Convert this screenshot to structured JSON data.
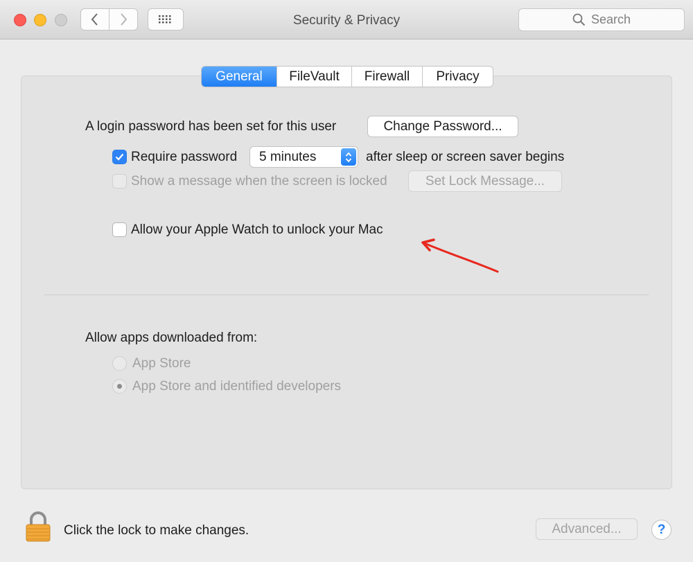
{
  "window": {
    "title": "Security & Privacy",
    "search_placeholder": "Search"
  },
  "tabs": [
    {
      "label": "General",
      "active": true
    },
    {
      "label": "FileVault",
      "active": false
    },
    {
      "label": "Firewall",
      "active": false
    },
    {
      "label": "Privacy",
      "active": false
    }
  ],
  "general": {
    "login_text": "A login password has been set for this user",
    "change_password_button": "Change Password...",
    "require_password": {
      "label": "Require password",
      "checked": true
    },
    "delay_select": {
      "value": "5 minutes"
    },
    "after_sleep_text": "after sleep or screen saver begins",
    "show_message": {
      "label": "Show a message when the screen is locked",
      "checked": false,
      "enabled": false
    },
    "set_lock_message_button": "Set Lock Message...",
    "apple_watch": {
      "label": "Allow your Apple Watch to unlock your Mac",
      "checked": false
    }
  },
  "allow_apps": {
    "heading": "Allow apps downloaded from:",
    "options": [
      {
        "label": "App Store",
        "selected": false
      },
      {
        "label": "App Store and identified developers",
        "selected": true
      }
    ]
  },
  "footer": {
    "lock_text": "Click the lock to make changes.",
    "advanced_button": "Advanced...",
    "help_label": "?"
  },
  "colors": {
    "accent": "#1f7ef4",
    "annotation_arrow": "#e8291f"
  },
  "icons": {
    "back": "chevron-left-icon",
    "forward": "chevron-right-icon",
    "grid": "grid-icon",
    "search": "magnifier-icon",
    "lock": "padlock-icon",
    "checkmark": "checkmark-icon",
    "select_arrows": "up-down-chevron-icon"
  }
}
